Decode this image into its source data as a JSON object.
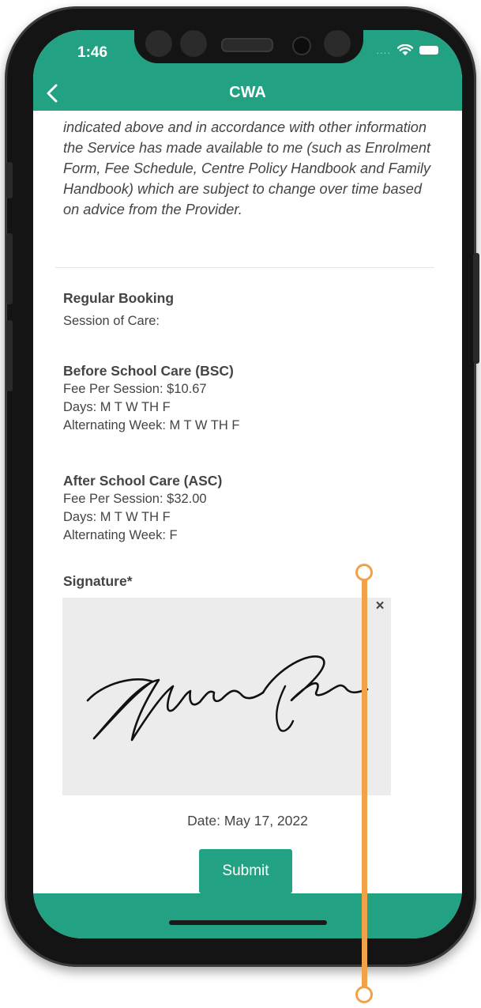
{
  "status_bar": {
    "time": "1:46",
    "signal": "....",
    "accent_color": "#23a283"
  },
  "nav": {
    "title": "CWA",
    "back_icon": "chevron-left-icon"
  },
  "agreement": {
    "text": "indicated above and in accordance with other information the Service has made available to me (such as Enrolment Form, Fee Schedule, Centre Policy Handbook and Family Handbook) which are subject to change over time based on advice from the Provider."
  },
  "regular_booking": {
    "title": "Regular Booking",
    "session_label": "Session of Care:"
  },
  "bsc": {
    "title": "Before School Care (BSC)",
    "fee": "Fee Per Session: $10.67",
    "days": "Days: M T W TH F",
    "alternating": "Alternating Week: M T W TH F"
  },
  "asc": {
    "title": "After School Care (ASC)",
    "fee": "Fee Per Session: $32.00",
    "days": "Days: M T W TH F",
    "alternating": "Alternating Week: F"
  },
  "signature": {
    "label": "Signature*",
    "clear_icon": "×"
  },
  "date_text": "Date: May 17, 2022",
  "submit_label": "Submit"
}
